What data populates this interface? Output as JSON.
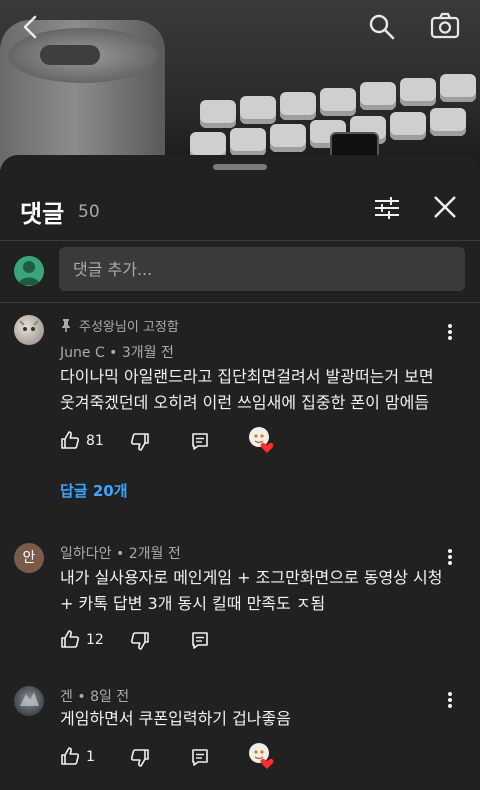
{
  "comments_panel": {
    "title": "댓글",
    "count": "50",
    "add_placeholder": "댓글 추가..."
  },
  "comments": [
    {
      "pinned_text": "주성왕님이 고정함",
      "author": "June C",
      "time": "3개월 전",
      "text_line1": "다이나믹 아일랜드라고 집단최면걸려서 발광떠는거 보면",
      "text_line2": "웃겨죽겠던데 오히려 이런 쓰임새에 집중한 폰이 맘에듬",
      "likes": "81",
      "replies_label": "답글 20개"
    },
    {
      "avatar_letter": "안",
      "author": "일하다안",
      "time": "2개월 전",
      "text_line1": "내가 실사용자로 메인게임 + 조그만화면으로 동영상 시청",
      "text_line2": "+ 카톡 답변 3개 동시 킬때 만족도 ㅈ됨",
      "likes": "12"
    },
    {
      "author": "겐",
      "time": "8일 전",
      "text_line1": "게임하면서 쿠폰입력하기 겁나좋음",
      "likes": "1"
    }
  ],
  "colors": {
    "sheet_bg": "#212121",
    "link_blue": "#3ea6ff",
    "heart_red": "#ff2d2d"
  }
}
